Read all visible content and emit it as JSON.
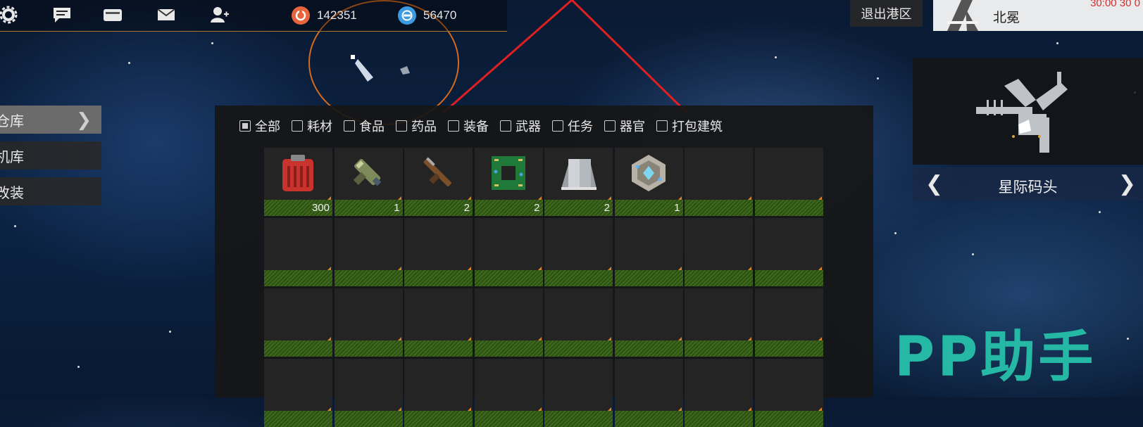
{
  "topbar": {
    "icons": [
      "gear-icon",
      "chat-icon",
      "card-icon",
      "mail-icon",
      "add-friend-icon"
    ],
    "resources": [
      {
        "name": "credits",
        "icon": "credit-icon",
        "value": "142351",
        "color": "#e8643c"
      },
      {
        "name": "alloy",
        "icon": "alloy-icon",
        "value": "56470",
        "color": "#3c9be0"
      }
    ]
  },
  "sidebar": {
    "items": [
      {
        "label": "仓库",
        "active": true
      },
      {
        "label": "机库",
        "active": false
      },
      {
        "label": "改装",
        "active": false
      }
    ]
  },
  "filters": [
    {
      "label": "全部",
      "checked": true
    },
    {
      "label": "耗材",
      "checked": false
    },
    {
      "label": "食品",
      "checked": false
    },
    {
      "label": "药品",
      "checked": false
    },
    {
      "label": "装备",
      "checked": false
    },
    {
      "label": "武器",
      "checked": false
    },
    {
      "label": "任务",
      "checked": false
    },
    {
      "label": "器官",
      "checked": false
    },
    {
      "label": "打包建筑",
      "checked": false
    }
  ],
  "inventory": {
    "rows": [
      [
        {
          "icon": "fuel-canister-icon",
          "qty": "300"
        },
        {
          "icon": "plasma-gun-icon",
          "qty": "1"
        },
        {
          "icon": "rifle-icon",
          "qty": "2"
        },
        {
          "icon": "circuit-board-icon",
          "qty": "2"
        },
        {
          "icon": "metal-plates-icon",
          "qty": "2"
        },
        {
          "icon": "crystal-core-icon",
          "qty": "1"
        },
        {
          "icon": "",
          "qty": ""
        },
        {
          "icon": "",
          "qty": ""
        }
      ],
      [
        {
          "icon": "",
          "qty": ""
        },
        {
          "icon": "",
          "qty": ""
        },
        {
          "icon": "",
          "qty": ""
        },
        {
          "icon": "",
          "qty": ""
        },
        {
          "icon": "",
          "qty": ""
        },
        {
          "icon": "",
          "qty": ""
        },
        {
          "icon": "",
          "qty": ""
        },
        {
          "icon": "",
          "qty": ""
        }
      ],
      [
        {
          "icon": "",
          "qty": ""
        },
        {
          "icon": "",
          "qty": ""
        },
        {
          "icon": "",
          "qty": ""
        },
        {
          "icon": "",
          "qty": ""
        },
        {
          "icon": "",
          "qty": ""
        },
        {
          "icon": "",
          "qty": ""
        },
        {
          "icon": "",
          "qty": ""
        },
        {
          "icon": "",
          "qty": ""
        }
      ],
      [
        {
          "icon": "",
          "qty": ""
        },
        {
          "icon": "",
          "qty": ""
        },
        {
          "icon": "",
          "qty": ""
        },
        {
          "icon": "",
          "qty": ""
        },
        {
          "icon": "",
          "qty": ""
        },
        {
          "icon": "",
          "qty": ""
        },
        {
          "icon": "",
          "qty": ""
        },
        {
          "icon": "",
          "qty": ""
        }
      ]
    ]
  },
  "right": {
    "exit_label": "退出港区",
    "location_name": "北冕",
    "time_text": "30:00 30 0",
    "station_name": "星际码头",
    "prev_arrow": "❮",
    "next_arrow": "❯"
  },
  "watermark": "PP助手",
  "colors": {
    "accent_gold": "#a07a2a",
    "radar_orange": "#d46a1c",
    "laser_red": "#e02020",
    "slot_bar_green": "#3f6a1e",
    "watermark": "#25b8a4"
  }
}
